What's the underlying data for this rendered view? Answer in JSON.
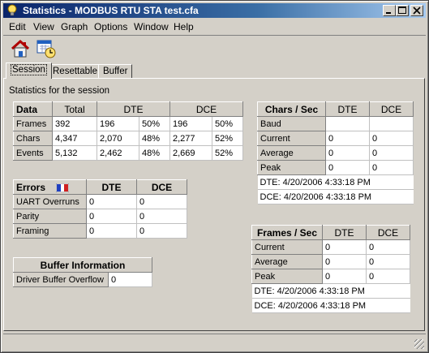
{
  "window": {
    "title": "Statistics - MODBUS RTU STA test.cfa"
  },
  "menu": [
    "Edit",
    "View",
    "Graph",
    "Options",
    "Window",
    "Help"
  ],
  "toolbar": [
    {
      "icon": "home-icon"
    },
    {
      "icon": "calendar-clock-icon"
    }
  ],
  "tabs": [
    "Session",
    "Resettable",
    "Buffer"
  ],
  "session_caption": "Statistics for the session",
  "data_table": {
    "headers": [
      "Data",
      "Total",
      "DTE",
      "DCE"
    ],
    "rows": [
      {
        "label": "Frames",
        "total": "392",
        "dte": "196",
        "dte_pct": "50%",
        "dce": "196",
        "dce_pct": "50%"
      },
      {
        "label": "Chars",
        "total": "4,347",
        "dte": "2,070",
        "dte_pct": "48%",
        "dce": "2,277",
        "dce_pct": "52%"
      },
      {
        "label": "Events",
        "total": "5,132",
        "dte": "2,462",
        "dte_pct": "48%",
        "dce": "2,669",
        "dce_pct": "52%"
      }
    ]
  },
  "errors_table": {
    "headers": [
      "Errors",
      "DTE",
      "DCE"
    ],
    "rows": [
      {
        "label": "UART Overruns",
        "dte": "0",
        "dce": "0"
      },
      {
        "label": "Parity",
        "dte": "0",
        "dce": "0"
      },
      {
        "label": "Framing",
        "dte": "0",
        "dce": "0"
      }
    ]
  },
  "buffer_table": {
    "header": "Buffer Information",
    "rows": [
      {
        "label": "Driver Buffer Overflow",
        "value": "0"
      }
    ]
  },
  "chars_table": {
    "headers": [
      "Chars / Sec",
      "DTE",
      "DCE"
    ],
    "rows": [
      {
        "label": "Baud",
        "dte": "",
        "dce": ""
      },
      {
        "label": "Current",
        "dte": "0",
        "dce": "0"
      },
      {
        "label": "Average",
        "dte": "0",
        "dce": "0"
      },
      {
        "label": "Peak",
        "dte": "0",
        "dce": "0"
      }
    ],
    "dte_time": "DTE: 4/20/2006 4:33:18 PM",
    "dce_time": "DCE: 4/20/2006 4:33:18 PM"
  },
  "frames_table": {
    "headers": [
      "Frames / Sec",
      "DTE",
      "DCE"
    ],
    "rows": [
      {
        "label": "Current",
        "dte": "0",
        "dce": "0"
      },
      {
        "label": "Average",
        "dte": "0",
        "dce": "0"
      },
      {
        "label": "Peak",
        "dte": "0",
        "dce": "0"
      }
    ],
    "dte_time": "DTE: 4/20/2006 4:33:18 PM",
    "dce_time": "DCE: 4/20/2006 4:33:18 PM"
  },
  "colors": {
    "titlebar_start": "#0a246a",
    "titlebar_end": "#a6caf0",
    "face": "#d4d0c8"
  }
}
